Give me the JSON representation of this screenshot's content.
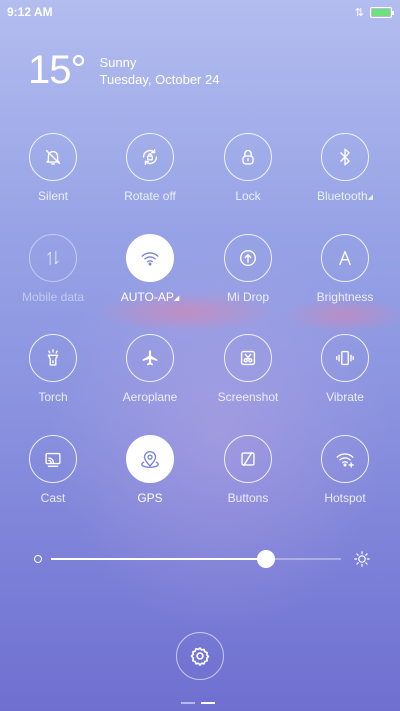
{
  "status_bar": {
    "time": "9:12 AM",
    "signal_icon": "data-arrows-icon",
    "battery_icon": "battery-full-icon",
    "battery_color": "#6fe07a"
  },
  "weather": {
    "temperature": "15°",
    "condition": "Sunny",
    "date": "Tuesday, October 24"
  },
  "tiles": [
    {
      "label": "Silent",
      "icon": "bell-off-icon",
      "state": "off"
    },
    {
      "label": "Rotate off",
      "icon": "rotate-lock-icon",
      "state": "off"
    },
    {
      "label": "Lock",
      "icon": "lock-icon",
      "state": "off"
    },
    {
      "label": "Bluetooth",
      "icon": "bluetooth-icon",
      "state": "off",
      "has_menu": true
    },
    {
      "label": "Mobile data",
      "icon": "mobile-data-icon",
      "state": "disabled"
    },
    {
      "label": "AUTO-AP",
      "icon": "wifi-icon",
      "state": "on",
      "has_menu": true
    },
    {
      "label": "Mi Drop",
      "icon": "mi-drop-icon",
      "state": "off"
    },
    {
      "label": "Brightness",
      "icon": "auto-brightness-icon",
      "state": "off"
    },
    {
      "label": "Torch",
      "icon": "torch-icon",
      "state": "off"
    },
    {
      "label": "Aeroplane",
      "icon": "airplane-icon",
      "state": "off"
    },
    {
      "label": "Screenshot",
      "icon": "screenshot-icon",
      "state": "off"
    },
    {
      "label": "Vibrate",
      "icon": "vibrate-icon",
      "state": "off"
    },
    {
      "label": "Cast",
      "icon": "cast-icon",
      "state": "off"
    },
    {
      "label": "GPS",
      "icon": "gps-icon",
      "state": "on"
    },
    {
      "label": "Buttons",
      "icon": "buttons-icon",
      "state": "off"
    },
    {
      "label": "Hotspot",
      "icon": "hotspot-icon",
      "state": "off"
    }
  ],
  "brightness": {
    "level": 0.74,
    "min_icon": "brightness-low-icon",
    "max_icon": "brightness-high-icon"
  },
  "footer": {
    "settings_icon": "gear-icon",
    "pages": 2,
    "active_page": 1
  }
}
